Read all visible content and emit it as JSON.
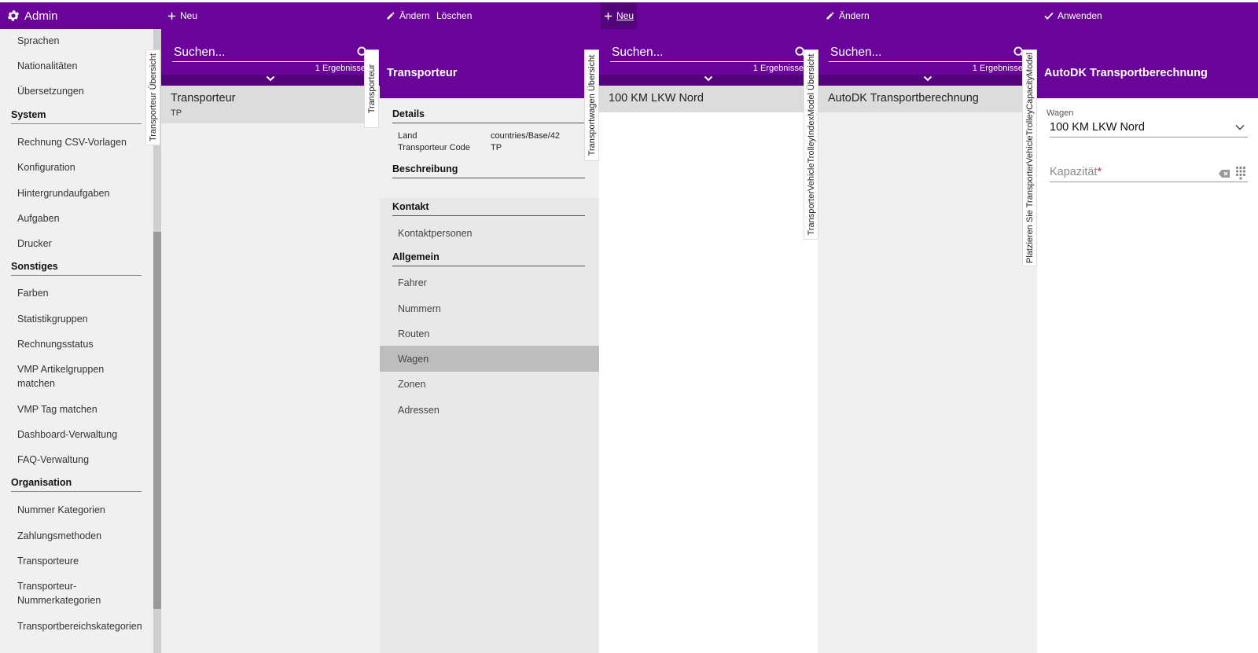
{
  "colors": {
    "brand": "#6a0399",
    "brand_dark": "#54047a",
    "selected_row": "#dcdcdc",
    "required": "#e02020"
  },
  "topbar": {
    "app_title": "Admin",
    "pane1_new": "Neu",
    "pane2_edit": "Ändern",
    "pane2_delete": "Löschen",
    "pane3_new": "Neu",
    "pane4_edit": "Ändern",
    "pane5_apply": "Anwenden"
  },
  "sidebar": {
    "items_top": [
      "Sprachen",
      "Nationalitäten",
      "Übersetzungen"
    ],
    "sections": [
      {
        "title": "System",
        "items": [
          "Rechnung CSV-Vorlagen",
          "Konfiguration",
          "Hintergrundaufgaben",
          "Aufgaben",
          "Drucker"
        ]
      },
      {
        "title": "Sonstiges",
        "items": [
          "Farben",
          "Statistikgruppen",
          "Rechnungsstatus",
          "VMP Artikelgruppen matchen",
          "VMP Tag matchen",
          "Dashboard-Verwaltung",
          "FAQ-Verwaltung"
        ]
      },
      {
        "title": "Organisation",
        "items": [
          "Nummer Kategorien",
          "Zahlungsmethoden",
          "Transporteure",
          "Transporteur-Nummerkategorien",
          "Transportbereichskategorien"
        ]
      }
    ]
  },
  "pane1": {
    "search_placeholder": "Suchen...",
    "result_count": "1 Ergebnisse",
    "row_title": "Transporteur",
    "row_subtitle": "TP",
    "vtab": "Transporteur Übersicht"
  },
  "pane2": {
    "title": "Transporteur",
    "vtab": "Transporteur",
    "details_heading": "Details",
    "fields": [
      {
        "label": "Land",
        "value": "countries/Base/42"
      },
      {
        "label": "Transporteur Code",
        "value": "TP"
      }
    ],
    "description_heading": "Beschreibung",
    "contact_heading": "Kontakt",
    "contact_items": [
      "Kontaktpersonen"
    ],
    "general_heading": "Allgemein",
    "general_items": [
      "Fahrer",
      "Nummern",
      "Routen",
      "Wagen",
      "Zonen",
      "Adressen"
    ],
    "selected_item": "Wagen"
  },
  "pane3": {
    "search_placeholder": "Suchen...",
    "result_count": "1 Ergebnisse",
    "row_title": "100 KM LKW Nord",
    "vtab": "Transportwagen Übersicht"
  },
  "pane4": {
    "search_placeholder": "Suchen...",
    "result_count": "1 Ergebnisse",
    "row_title": "AutoDK Transportberechnung",
    "vtab": "TransporterVehicleTrolleyIndexModel Übersicht"
  },
  "pane5": {
    "title": "AutoDK Transportberechnung",
    "vtab": "Platzieren Sie TransporterVehicleTrolleyCapacityModel",
    "wagen_label": "Wagen",
    "wagen_value": "100 KM LKW Nord",
    "capacity_placeholder": "Kapazität",
    "required_marker": "*"
  }
}
